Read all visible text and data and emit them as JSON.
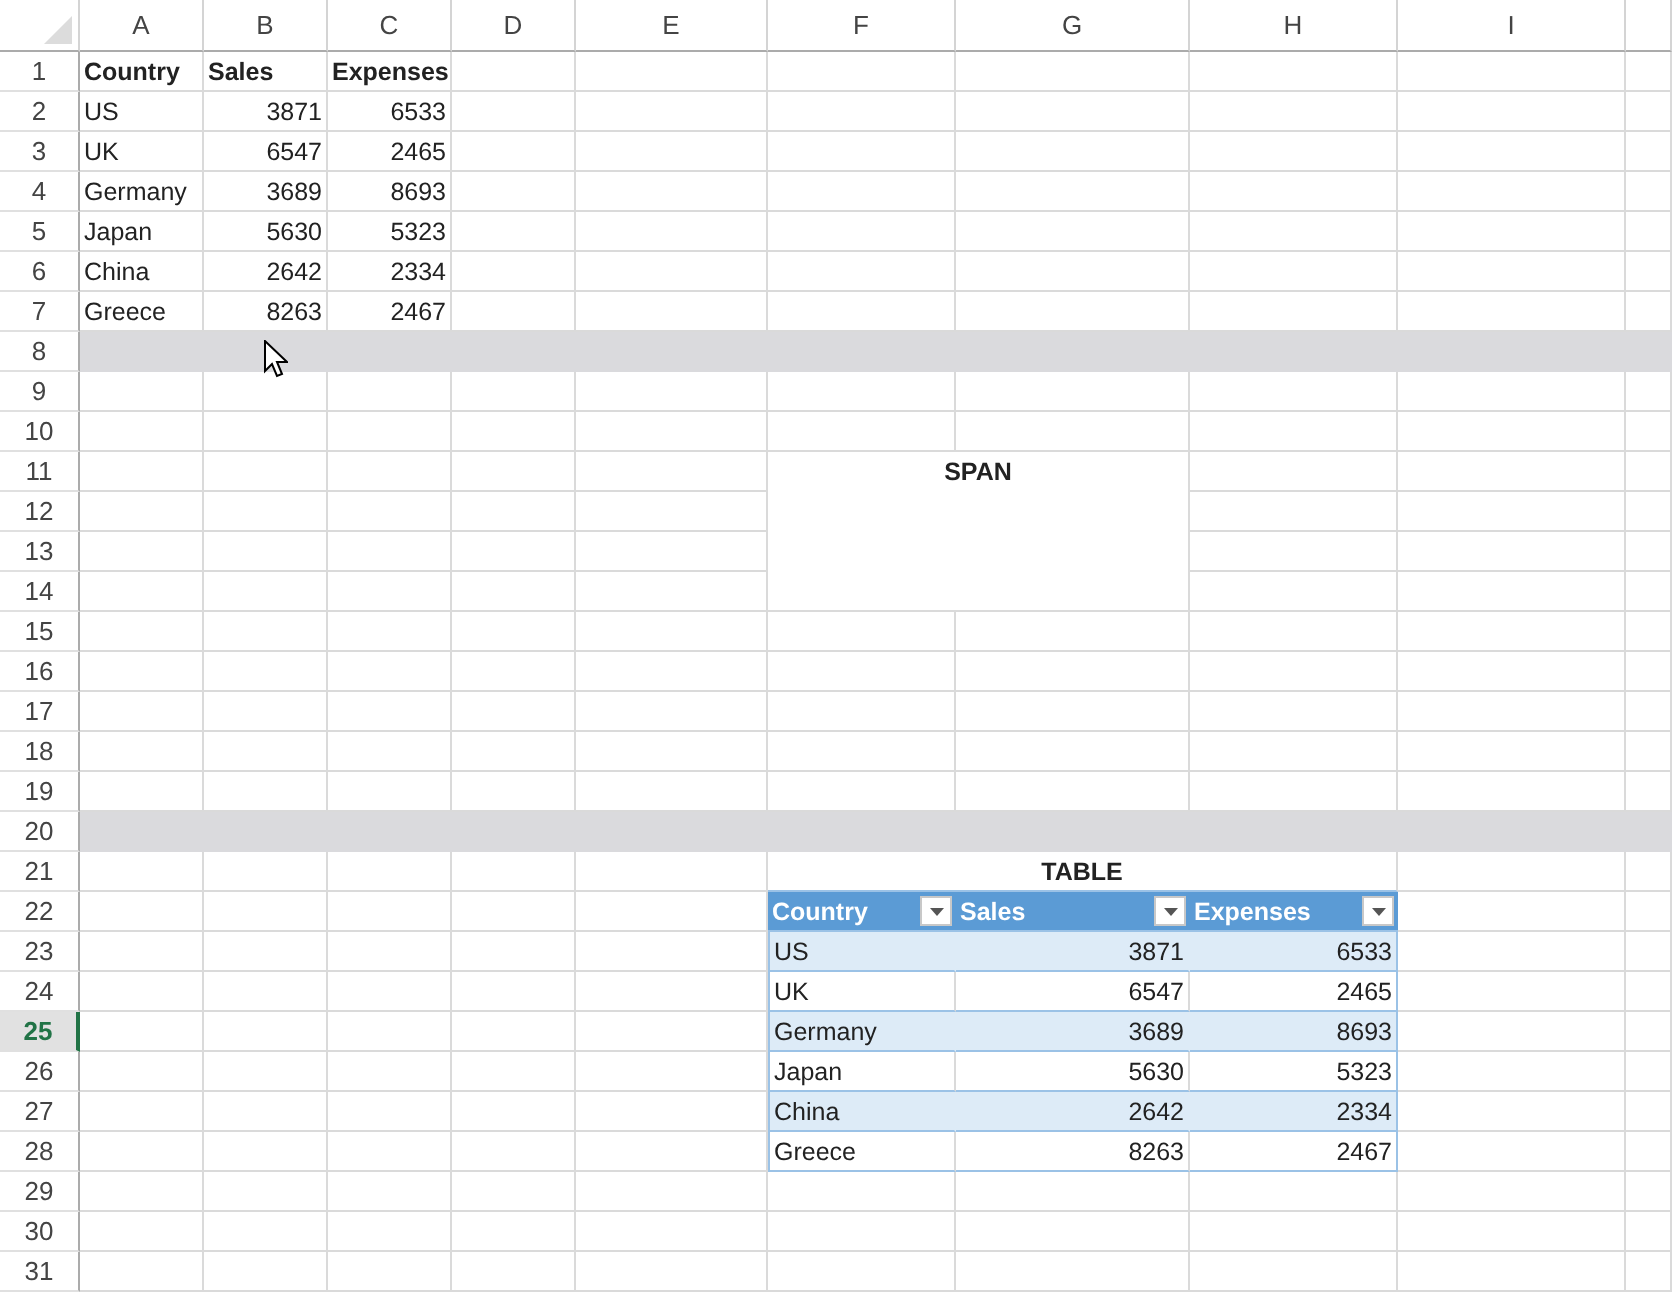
{
  "column_headers": [
    {
      "label": "A"
    },
    {
      "label": "B"
    },
    {
      "label": "C"
    },
    {
      "label": "D"
    },
    {
      "label": "E"
    },
    {
      "label": "F"
    },
    {
      "label": "G"
    },
    {
      "label": "H"
    },
    {
      "label": "I"
    }
  ],
  "row_headers": [
    {
      "label": "1",
      "selected": false,
      "highlighted": false
    },
    {
      "label": "2",
      "selected": false,
      "highlighted": false
    },
    {
      "label": "3",
      "selected": false,
      "highlighted": false
    },
    {
      "label": "4",
      "selected": false,
      "highlighted": false
    },
    {
      "label": "5",
      "selected": false,
      "highlighted": false
    },
    {
      "label": "6",
      "selected": false,
      "highlighted": false
    },
    {
      "label": "7",
      "selected": false,
      "highlighted": false
    },
    {
      "label": "8",
      "selected": false,
      "highlighted": true
    },
    {
      "label": "9",
      "selected": false,
      "highlighted": false
    },
    {
      "label": "10",
      "selected": false,
      "highlighted": false
    },
    {
      "label": "11",
      "selected": false,
      "highlighted": false
    },
    {
      "label": "12",
      "selected": false,
      "highlighted": false
    },
    {
      "label": "13",
      "selected": false,
      "highlighted": false
    },
    {
      "label": "14",
      "selected": false,
      "highlighted": false
    },
    {
      "label": "15",
      "selected": false,
      "highlighted": false
    },
    {
      "label": "16",
      "selected": false,
      "highlighted": false
    },
    {
      "label": "17",
      "selected": false,
      "highlighted": false
    },
    {
      "label": "18",
      "selected": false,
      "highlighted": false
    },
    {
      "label": "19",
      "selected": false,
      "highlighted": false
    },
    {
      "label": "20",
      "selected": false,
      "highlighted": true
    },
    {
      "label": "21",
      "selected": false,
      "highlighted": false
    },
    {
      "label": "22",
      "selected": false,
      "highlighted": false
    },
    {
      "label": "23",
      "selected": false,
      "highlighted": false
    },
    {
      "label": "24",
      "selected": false,
      "highlighted": false
    },
    {
      "label": "25",
      "selected": true,
      "highlighted": false
    },
    {
      "label": "26",
      "selected": false,
      "highlighted": false
    },
    {
      "label": "27",
      "selected": false,
      "highlighted": false
    },
    {
      "label": "28",
      "selected": false,
      "highlighted": false
    },
    {
      "label": "29",
      "selected": false,
      "highlighted": false
    },
    {
      "label": "30",
      "selected": false,
      "highlighted": false
    },
    {
      "label": "31",
      "selected": false,
      "highlighted": false
    }
  ],
  "data_range": {
    "header": [
      "Country",
      "Sales",
      "Expenses"
    ],
    "rows": [
      [
        "US",
        "3871",
        "6533"
      ],
      [
        "UK",
        "6547",
        "2465"
      ],
      [
        "Germany",
        "3689",
        "8693"
      ],
      [
        "Japan",
        "5630",
        "5323"
      ],
      [
        "China",
        "2642",
        "2334"
      ],
      [
        "Greece",
        "8263",
        "2467"
      ]
    ]
  },
  "span": {
    "label": "SPAN"
  },
  "table": {
    "title": "TABLE",
    "columns": [
      "Country",
      "Sales",
      "Expenses"
    ],
    "rows": [
      [
        "US",
        "3871",
        "6533"
      ],
      [
        "UK",
        "6547",
        "2465"
      ],
      [
        "Germany",
        "3689",
        "8693"
      ],
      [
        "Japan",
        "5630",
        "5323"
      ],
      [
        "China",
        "2642",
        "2334"
      ],
      [
        "Greece",
        "8263",
        "2467"
      ]
    ]
  }
}
